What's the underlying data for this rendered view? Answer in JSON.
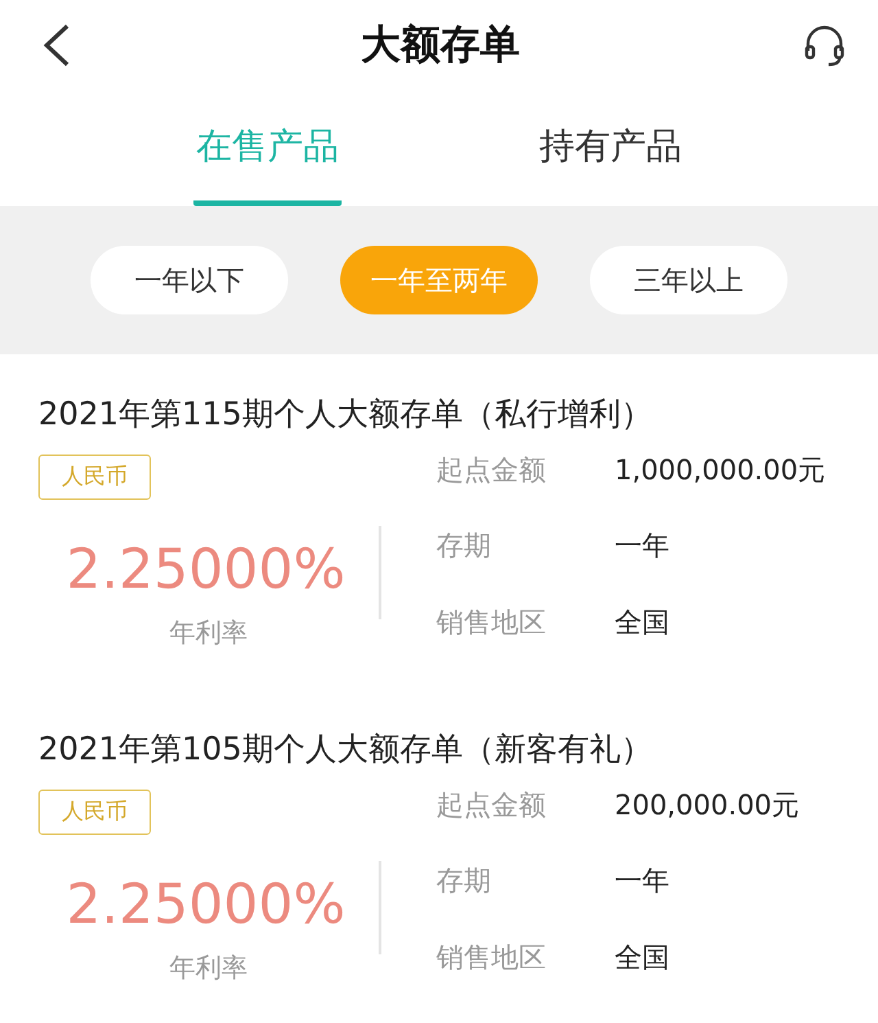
{
  "header": {
    "title": "大额存单"
  },
  "tabs": [
    {
      "label": "在售产品",
      "selected": true
    },
    {
      "label": "持有产品",
      "selected": false
    }
  ],
  "filters": [
    {
      "label": "一年以下",
      "selected": false
    },
    {
      "label": "一年至两年",
      "selected": true
    },
    {
      "label": "三年以上",
      "selected": false
    }
  ],
  "products": [
    {
      "title": "2021年第115期个人大额存单（私行增利）",
      "currency": "人民币",
      "rate": "2.25000%",
      "rate_label": "年利率",
      "details": [
        {
          "label": "起点金额",
          "value": "1,000,000.00元"
        },
        {
          "label": "存期",
          "value": "一年"
        },
        {
          "label": "销售地区",
          "value": "全国"
        }
      ]
    },
    {
      "title": "2021年第105期个人大额存单（新客有礼）",
      "currency": "人民币",
      "rate": "2.25000%",
      "rate_label": "年利率",
      "details": [
        {
          "label": "起点金额",
          "value": "200,000.00元"
        },
        {
          "label": "存期",
          "value": "一年"
        },
        {
          "label": "销售地区",
          "value": "全国"
        }
      ]
    }
  ]
}
